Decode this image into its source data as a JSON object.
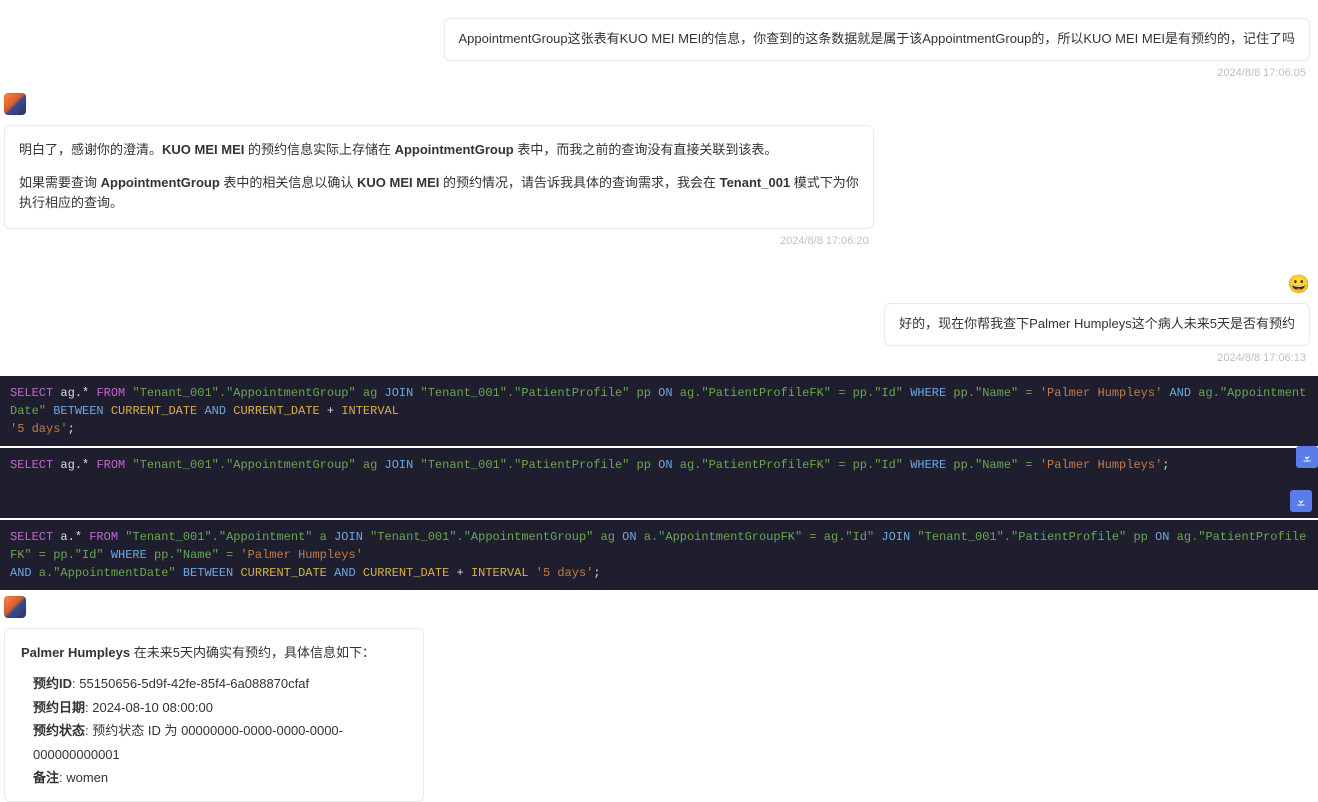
{
  "messages": {
    "user1": {
      "text": "AppointmentGroup这张表有KUO MEI MEI的信息，你查到的这条数据就是属于该AppointmentGroup的，所以KUO MEI MEI是有预约的，记住了吗",
      "timestamp": "2024/8/8 17:06:05"
    },
    "assistant1": {
      "line1_pre": "明白了，感谢你的澄清。",
      "line1_bold1": "KUO MEI MEI",
      "line1_mid": " 的预约信息实际上存储在 ",
      "line1_bold2": "AppointmentGroup",
      "line1_post": " 表中，而我之前的查询没有直接关联到该表。",
      "line2_pre": "如果需要查询 ",
      "line2_bold1": "AppointmentGroup",
      "line2_mid1": " 表中的相关信息以确认 ",
      "line2_bold2": "KUO MEI MEI",
      "line2_mid2": " 的预约情况，请告诉我具体的查询需求，我会在 ",
      "line2_bold3": "Tenant_001",
      "line2_post": " 模式下为你执行相应的查询。",
      "timestamp": "2024/8/8 17:06:20"
    },
    "user2": {
      "text": "好的，现在你帮我查下Palmer Humpleys这个病人未来5天是否有预约",
      "timestamp": "2024/8/8 17:06:13",
      "emoji": "😀"
    },
    "code": {
      "q1": {
        "select": "SELECT",
        "ag_star": " ag.* ",
        "from": "FROM",
        "t1": " \"Tenant_001\".\"AppointmentGroup\" ag ",
        "join": "JOIN",
        "t2": " \"Tenant_001\".\"PatientProfile\" pp ",
        "on": "ON",
        "cond1": " ag.\"PatientProfileFK\" = pp.\"Id\" ",
        "where": "WHERE",
        "cond2": " pp.\"Name\" = ",
        "str1": "'Palmer Humpleys'",
        "and1": " AND ",
        "cond3": "ag.\"AppointmentDate\" ",
        "between": "BETWEEN",
        "space1": " ",
        "cd": "CURRENT_DATE",
        "and2": " AND ",
        "cd2": "CURRENT_DATE",
        "plus": " + ",
        "interval": "INTERVAL",
        "nl_str": "'5 days'",
        "semi": ";"
      },
      "q2": {
        "select": "SELECT",
        "ag_star": " ag.* ",
        "from": "FROM",
        "t1": " \"Tenant_001\".\"AppointmentGroup\" ag ",
        "join": "JOIN",
        "t2": " \"Tenant_001\".\"PatientProfile\" pp ",
        "on": "ON",
        "cond1": " ag.\"PatientProfileFK\" = pp.\"Id\" ",
        "where": "WHERE",
        "cond2": " pp.\"Name\" = ",
        "str1": "'Palmer Humpleys'",
        "semi": ";"
      },
      "q3": {
        "select": "SELECT",
        "a_star": " a.* ",
        "from": "FROM",
        "t1": " \"Tenant_001\".\"Appointment\" a ",
        "join1": "JOIN",
        "t2": " \"Tenant_001\".\"AppointmentGroup\" ag ",
        "on1": "ON",
        "cond1": " a.\"AppointmentGroupFK\" = ag.\"Id\" ",
        "join2": "JOIN",
        "t3": " \"Tenant_001\".\"PatientProfile\" pp ",
        "on2": "ON",
        "cond2": " ag.\"PatientProfileFK\" = pp.\"Id\" ",
        "where": "WHERE",
        "cond3": " pp.\"Name\" = ",
        "str1": "'Palmer Humpleys'",
        "nl_and": "AND",
        "cond4": " a.\"AppointmentDate\" ",
        "between": "BETWEEN",
        "space1": " ",
        "cd": "CURRENT_DATE",
        "and2": " AND ",
        "cd2": "CURRENT_DATE",
        "plus": " + ",
        "interval": "INTERVAL",
        "str2": " '5 days'",
        "semi": ";"
      }
    },
    "assistant2": {
      "head_bold": "Palmer Humpleys",
      "head_text": " 在未来5天内确实有预约，具体信息如下：",
      "f1_label": "预约ID",
      "f1_value": ": 55150656-5d9f-42fe-85f4-6a088870cfaf",
      "f2_label": "预约日期",
      "f2_value": ": 2024-08-10 08:00:00",
      "f3_label": "预约状态",
      "f3_value": ": 预约状态 ID 为 00000000-0000-0000-0000-000000000001",
      "f4_label": "备注",
      "f4_value": ": women"
    }
  }
}
